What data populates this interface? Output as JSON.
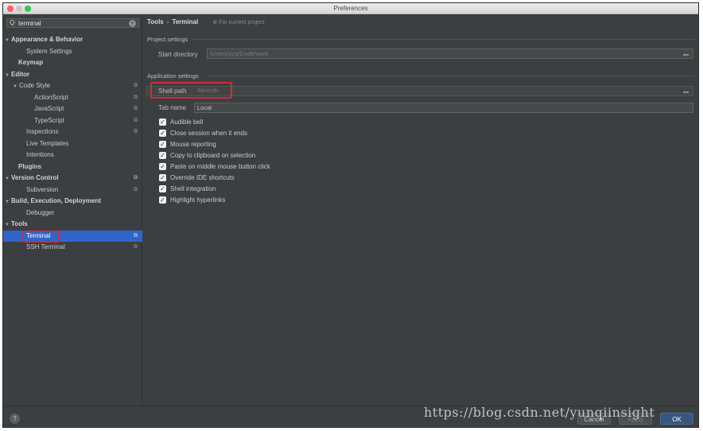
{
  "window": {
    "title": "Preferences"
  },
  "search": {
    "value": "terminal"
  },
  "sidebar": {
    "items": [
      {
        "label": "Appearance & Behavior"
      },
      {
        "label": "System Settings"
      },
      {
        "label": "Keymap"
      },
      {
        "label": "Editor"
      },
      {
        "label": "Code Style"
      },
      {
        "label": "ActionScript"
      },
      {
        "label": "JavaScript"
      },
      {
        "label": "TypeScript"
      },
      {
        "label": "Inspections"
      },
      {
        "label": "Live Templates"
      },
      {
        "label": "Intentions"
      },
      {
        "label": "Plugins"
      },
      {
        "label": "Version Control"
      },
      {
        "label": "Subversion"
      },
      {
        "label": "Build, Execution, Deployment"
      },
      {
        "label": "Debugger"
      },
      {
        "label": "Tools"
      },
      {
        "label": "Terminal"
      },
      {
        "label": "SSH Terminal"
      }
    ]
  },
  "breadcrumb": {
    "parent": "Tools",
    "separator": "›",
    "current": "Terminal",
    "scope": "For current project"
  },
  "project_settings": {
    "title": "Project settings",
    "start_directory_label": "Start directory",
    "start_directory_value": "/Users/yzq/Code/work"
  },
  "application_settings": {
    "title": "Application settings",
    "shell_path_label": "Shell path",
    "shell_path_value": "/bin/zsh",
    "tab_name_label": "Tab name",
    "tab_name_value": "Local",
    "checkboxes": [
      {
        "label": "Audible bell",
        "checked": true
      },
      {
        "label": "Close session when it ends",
        "checked": true
      },
      {
        "label": "Mouse reporting",
        "checked": true
      },
      {
        "label": "Copy to clipboard on selection",
        "checked": true
      },
      {
        "label": "Paste on middle mouse button click",
        "checked": true
      },
      {
        "label": "Override IDE shortcuts",
        "checked": true
      },
      {
        "label": "Shell integration",
        "checked": true
      },
      {
        "label": "Highlight hyperlinks",
        "checked": true
      }
    ]
  },
  "footer": {
    "help": "?",
    "cancel": "Cancel",
    "apply": "Apply",
    "ok": "OK"
  },
  "watermark": "https://blog.csdn.net/yunqiinsight",
  "colors": {
    "accent": "#2f65ca",
    "highlight": "#d9263a",
    "background": "#3c3f41"
  }
}
